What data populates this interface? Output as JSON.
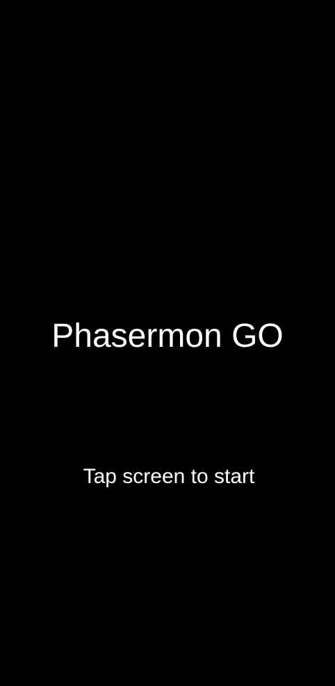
{
  "game": {
    "title": "Phasermon GO",
    "start_prompt": "Tap screen to start"
  },
  "colors": {
    "background": "#000000",
    "text": "#ffffff"
  }
}
